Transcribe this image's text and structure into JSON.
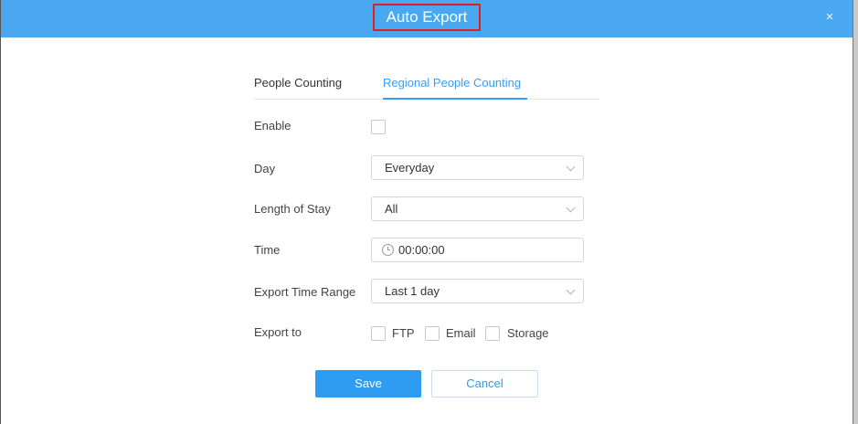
{
  "dialog": {
    "title": "Auto Export",
    "close_icon": "×"
  },
  "tabs": [
    {
      "label": "People Counting",
      "active": false
    },
    {
      "label": "Regional People Counting",
      "active": true
    }
  ],
  "form": {
    "enable": {
      "label": "Enable",
      "checked": false
    },
    "day": {
      "label": "Day",
      "value": "Everyday"
    },
    "length_of_stay": {
      "label": "Length of Stay",
      "value": "All"
    },
    "time": {
      "label": "Time",
      "value": "00:00:00"
    },
    "export_time_range": {
      "label": "Export Time Range",
      "value": "Last 1 day"
    },
    "export_to": {
      "label": "Export to",
      "options": [
        {
          "label": "FTP",
          "checked": false
        },
        {
          "label": "Email",
          "checked": false
        },
        {
          "label": "Storage",
          "checked": false
        }
      ]
    }
  },
  "buttons": {
    "save": "Save",
    "cancel": "Cancel"
  },
  "colors": {
    "header": "#4aa8f0",
    "accent": "#2e9cf0",
    "highlight_box": "#e02020"
  }
}
